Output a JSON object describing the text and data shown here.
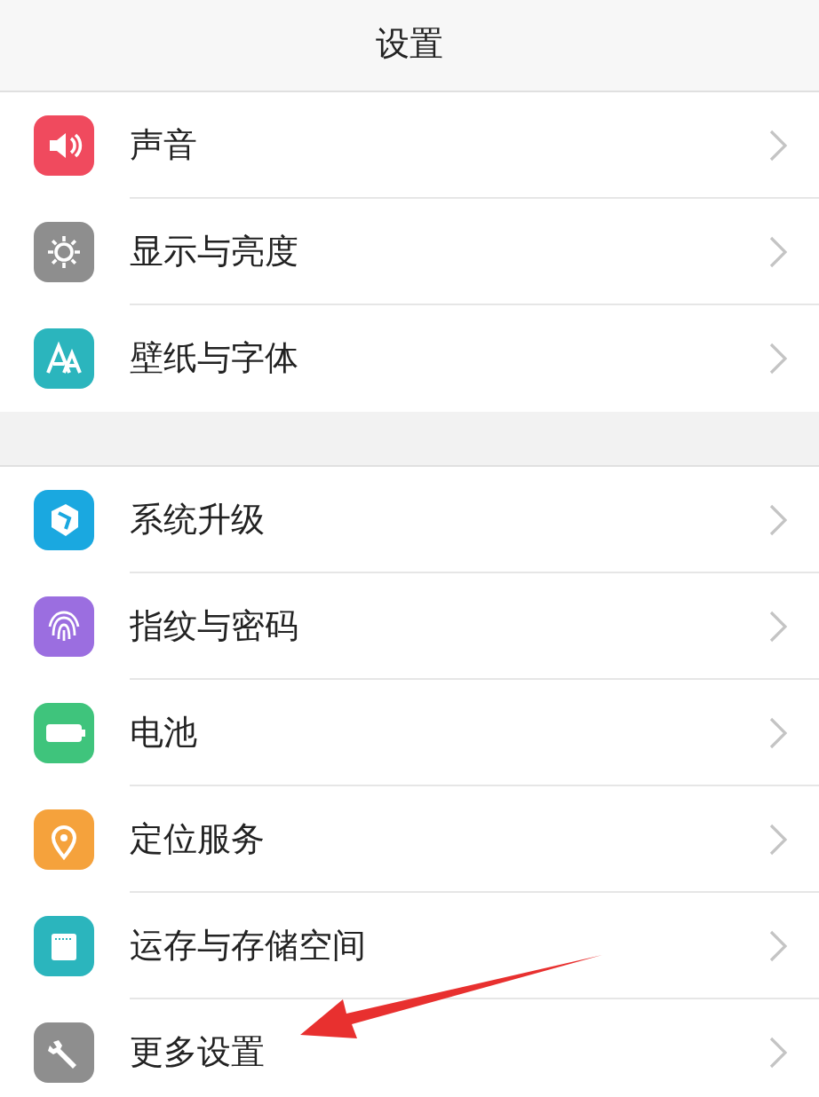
{
  "header": {
    "title": "设置"
  },
  "groups": [
    {
      "items": [
        {
          "label": "声音",
          "kind": "speaker",
          "color": "#f04a5e",
          "pointed": false
        },
        {
          "label": "显示与亮度",
          "kind": "sun",
          "color": "#8e8e8e",
          "pointed": false
        },
        {
          "label": "壁纸与字体",
          "kind": "letters",
          "color": "#2bb5bd",
          "pointed": false
        }
      ]
    },
    {
      "items": [
        {
          "label": "系统升级",
          "kind": "box",
          "color": "#1aa8e0",
          "pointed": false
        },
        {
          "label": "指纹与密码",
          "kind": "fingerprint",
          "color": "#9b6ee0",
          "pointed": false
        },
        {
          "label": "电池",
          "kind": "battery",
          "color": "#3fc47c",
          "pointed": false
        },
        {
          "label": "定位服务",
          "kind": "pin",
          "color": "#f5a23c",
          "pointed": false
        },
        {
          "label": "运存与存储空间",
          "kind": "card",
          "color": "#2bb5bd",
          "pointed": false
        },
        {
          "label": "更多设置",
          "kind": "wrench",
          "color": "#8e8e8e",
          "pointed": true
        }
      ]
    }
  ]
}
